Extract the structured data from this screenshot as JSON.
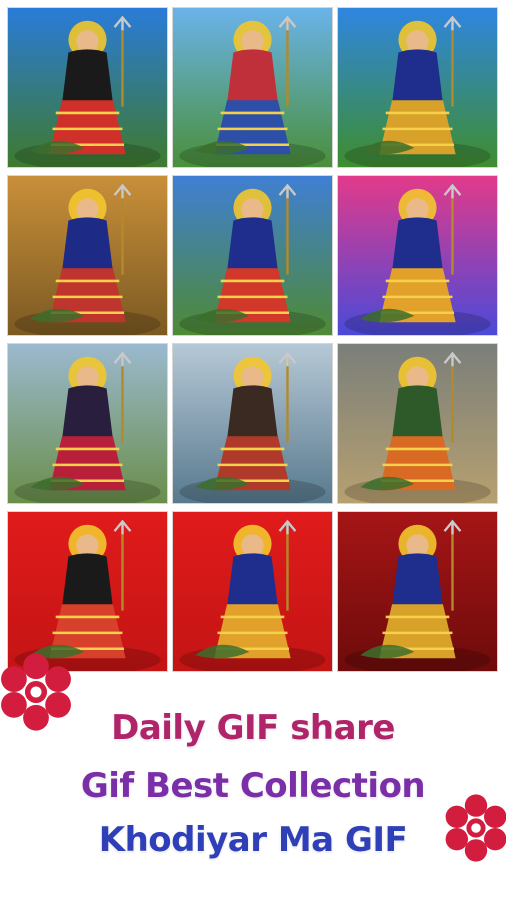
{
  "gallery": {
    "items": [
      {
        "title": "",
        "bg_top": "#2a7bd8",
        "bg_bottom": "#3f7a2e",
        "robe": "#1a1a1a",
        "skirt": "#d0302a"
      },
      {
        "title": "",
        "bg_top": "#6ab3ea",
        "bg_bottom": "#4a8f3a",
        "robe": "#c0303a",
        "skirt": "#2d4fa8"
      },
      {
        "title": "",
        "bg_top": "#2f86e0",
        "bg_bottom": "#3e8d2f",
        "robe": "#1f2e8c",
        "skirt": "#d8a12a"
      },
      {
        "title": "",
        "bg_top": "#c98f3a",
        "bg_bottom": "#7b5a22",
        "robe": "#1e2b86",
        "skirt": "#c0342e"
      },
      {
        "title": "",
        "bg_top": "#3f7fd4",
        "bg_bottom": "#4f8a34",
        "robe": "#1f2e8c",
        "skirt": "#d2382a"
      },
      {
        "title": "",
        "bg_top": "#e23a8a",
        "bg_bottom": "#4a4ad8",
        "robe": "#1f2e8c",
        "skirt": "#e2a12a"
      },
      {
        "title": "",
        "bg_top": "#9bb9cf",
        "bg_bottom": "#6a8e4a",
        "robe": "#2a1e3e",
        "skirt": "#b8203a"
      },
      {
        "title": "",
        "bg_top": "#b6c8d6",
        "bg_bottom": "#587a8e",
        "robe": "#3a2a22",
        "skirt": "#b03a2a"
      },
      {
        "title": "",
        "bg_top": "#7a7f7a",
        "bg_bottom": "#b7a070",
        "robe": "#2e5a2a",
        "skirt": "#d86a24"
      },
      {
        "title": "",
        "bg_top": "#e01b1b",
        "bg_bottom": "#c41414",
        "robe": "#1a1a1a",
        "skirt": "#d7402a"
      },
      {
        "title": "",
        "bg_top": "#e01b1b",
        "bg_bottom": "#c41414",
        "robe": "#1f2e8c",
        "skirt": "#e2a12a"
      },
      {
        "title": "",
        "bg_top": "#a61516",
        "bg_bottom": "#6e0b0b",
        "robe": "#1f2e8c",
        "skirt": "#d8a12a"
      }
    ]
  },
  "captions": {
    "line1": "Daily GIF share",
    "line2": "Gif Best Collection",
    "line3": "Khodiyar Ma GIF"
  },
  "colors": {
    "line1": "#b0246a",
    "line2": "#7a2ea8",
    "line3": "#2f3fb8",
    "flower": "#d21d3f"
  },
  "icons": {
    "decor_left": "flower-icon",
    "decor_right": "flower-icon"
  }
}
